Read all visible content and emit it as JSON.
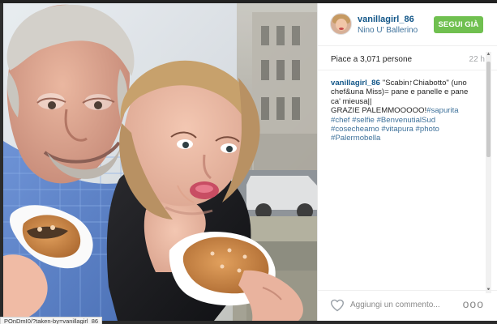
{
  "post": {
    "username": "vanillagirl_86",
    "location": "Nino U' Ballerino",
    "follow_button": "SEGUI GIÀ",
    "likes_text": "Piace a 3,071 persone",
    "time_ago": "22 h",
    "caption": {
      "username": "vanillagirl_86",
      "line1": "\"Scabin↑Chiabotto\" (uno",
      "line2": "chef&una Miss)= pane e panelle e pane",
      "line3": "ca' mieusa||",
      "line4": "GRAZIE PALEMMOOOOO!",
      "tag_sapurita": "#sapurita",
      "tag_chef": "#chef",
      "tag_selfie": "#selfie",
      "tag_benvenuti": "#BenvenutialSud",
      "tag_cosecheamo": "#cosecheamo",
      "tag_vitapura": "#vitapura",
      "tag_photo": "#photo",
      "tag_palermobella": "#Palermobella"
    },
    "comment_placeholder": "Aggiungi un commento...",
    "more_options": "ooo"
  },
  "browser": {
    "status_url": "POnDmI0/?taken-by=vanillagirl_86"
  },
  "colors": {
    "username": "#125688",
    "location": "#3f729b",
    "follow_button": "#70c050",
    "hashtag": "#3f729b"
  },
  "icons": {
    "heart": "heart-outline-icon",
    "avatar": "profile-avatar",
    "scroll_up": "scroll-up-arrow-icon",
    "scroll_down": "scroll-down-arrow-icon"
  }
}
